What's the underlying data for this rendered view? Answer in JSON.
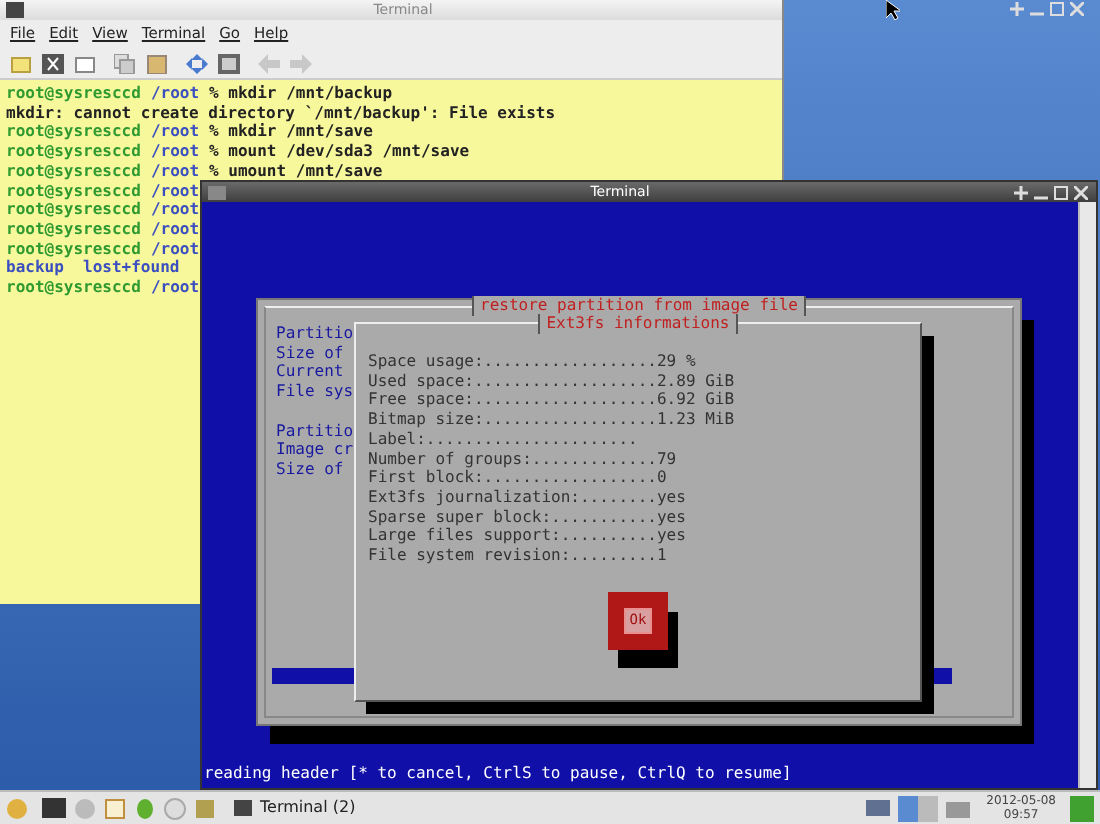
{
  "back_window": {
    "title": "Terminal",
    "menu": [
      "File",
      "Edit",
      "View",
      "Terminal",
      "Go",
      "Help"
    ],
    "lines": [
      {
        "kind": "prompt",
        "prompt": "root@sysresccd",
        "path": "/root",
        "command": "% mkdir /mnt/backup"
      },
      {
        "kind": "output",
        "text": "mkdir: cannot create directory `/mnt/backup': File exists"
      },
      {
        "kind": "prompt",
        "prompt": "root@sysresccd",
        "path": "/root",
        "command": "% mkdir /mnt/save"
      },
      {
        "kind": "prompt",
        "prompt": "root@sysresccd",
        "path": "/root",
        "command": "% mount /dev/sda3 /mnt/save"
      },
      {
        "kind": "prompt",
        "prompt": "root@sysresccd",
        "path": "/root",
        "command": "% umount /mnt/save"
      },
      {
        "kind": "prompt",
        "prompt": "root@sysresccd",
        "path": "/root"
      },
      {
        "kind": "prompt",
        "prompt": "root@sysresccd",
        "path": "/root"
      },
      {
        "kind": "prompt",
        "prompt": "root@sysresccd",
        "path": "/root"
      },
      {
        "kind": "prompt",
        "prompt": "root@sysresccd",
        "path": "/root"
      },
      {
        "kind": "listing",
        "text": "backup  lost+found"
      },
      {
        "kind": "prompt",
        "prompt": "root@sysresccd",
        "path": "/root"
      }
    ]
  },
  "front_window": {
    "title": "Terminal",
    "dialog": {
      "title": "restore partition from image file",
      "label_groups": [
        [
          "Partitio",
          "Size of",
          "Current",
          "File sys"
        ],
        [
          "Partitio",
          "Image cr",
          "Size of"
        ]
      ],
      "progress": {
        "level": 1
      },
      "info": {
        "title": "Ext3fs informations",
        "lines": [
          "Space usage:..................29 %",
          "Used space:...................2.89 GiB",
          "Free space:...................6.92 GiB",
          "Bitmap size:..................1.23 MiB",
          "Label:......................",
          "Number of groups:.............79",
          "First block:..................0",
          "Ext3fs journalization:........yes",
          "Sparse super block:...........yes",
          "Large files support:..........yes",
          "File system revision:.........1"
        ],
        "button": "Ok"
      }
    },
    "status_line": "reading header [* to cancel, CtrlS to pause, CtrlQ to resume]"
  },
  "taskbar": {
    "task": "Terminal (2)",
    "date": "2012-05-08",
    "time": "09:57"
  }
}
